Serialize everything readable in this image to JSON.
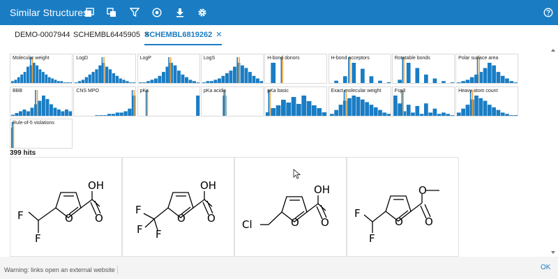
{
  "app": {
    "title": "Similar Structures"
  },
  "toolbar": {
    "icons": [
      "gallery-icon",
      "copy-icon",
      "filter-icon",
      "palette-icon",
      "download-icon",
      "gear-icon",
      "help-icon"
    ]
  },
  "tabs": [
    {
      "label": "DEMO-0007944",
      "closable": false,
      "active": false
    },
    {
      "label": "SCHEMBL6445905",
      "closable": true,
      "active": false
    },
    {
      "label": "SCHEMBL6819262",
      "closable": true,
      "active": true
    }
  ],
  "histograms": [
    {
      "label": "Molecular weight",
      "bars": [
        2,
        3,
        5,
        7,
        9,
        13,
        14,
        16,
        14,
        11,
        9,
        7,
        5,
        4,
        3,
        2,
        2,
        1,
        1,
        1
      ],
      "markers": [
        0.31,
        0.34
      ]
    },
    {
      "label": "LogD",
      "bars": [
        1,
        2,
        3,
        5,
        7,
        9,
        11,
        14,
        16,
        13,
        11,
        8,
        6,
        4,
        3,
        2,
        1,
        1
      ],
      "markers": [
        0.44,
        0.47
      ]
    },
    {
      "label": "LogP",
      "bars": [
        1,
        1,
        2,
        3,
        4,
        6,
        9,
        13,
        16,
        14,
        10,
        7,
        5,
        3,
        2,
        1
      ],
      "markers": [
        0.48,
        0.51
      ]
    },
    {
      "label": "LogS",
      "bars": [
        1,
        2,
        2,
        3,
        4,
        6,
        8,
        10,
        13,
        16,
        14,
        12,
        9,
        6,
        4,
        2
      ],
      "markers": [
        0.56,
        0.59
      ]
    },
    {
      "label": "H-bond donors",
      "bars": [
        0,
        16,
        0,
        0,
        0,
        0,
        0,
        0,
        0,
        0,
        0,
        0
      ],
      "markers": [
        0.25,
        0.27
      ]
    },
    {
      "label": "H-bond acceptors",
      "bars": [
        0,
        2,
        0,
        5,
        0,
        14,
        0,
        10,
        0,
        5,
        0,
        2,
        0,
        1
      ],
      "markers": [
        0.3,
        0.32
      ]
    },
    {
      "label": "Rotatable bonds",
      "bars": [
        0,
        3,
        0,
        16,
        0,
        12,
        0,
        7,
        0,
        4,
        0,
        2,
        0,
        1
      ],
      "markers": [
        0.15,
        0.17
      ]
    },
    {
      "label": "Polar surface area",
      "bars": [
        1,
        2,
        3,
        5,
        7,
        9,
        12,
        16,
        14,
        9,
        6,
        4,
        2,
        1
      ],
      "markers": [
        0.33,
        0.36
      ]
    },
    {
      "label": "BBB",
      "bars": [
        1,
        2,
        3,
        4,
        3,
        5,
        7,
        9,
        12,
        10,
        7,
        5,
        4,
        3,
        4,
        3
      ],
      "markers": [
        0.39,
        0.42
      ]
    },
    {
      "label": "CNS MPO",
      "bars": [
        0,
        0,
        0,
        0,
        0,
        1,
        1,
        1,
        2,
        2,
        3,
        3,
        4,
        6,
        16
      ],
      "markers": [
        0.92,
        0.95
      ]
    },
    {
      "label": "pKa",
      "bars": [
        0,
        0,
        0,
        0,
        0,
        0,
        0,
        0,
        0,
        0,
        0,
        0,
        0,
        0,
        16
      ],
      "markers": [
        0.12,
        0.14
      ]
    },
    {
      "label": "pKa acidic",
      "bars": [
        0,
        0,
        0,
        0,
        0,
        16,
        0,
        0,
        0,
        0,
        0,
        0,
        0,
        0,
        0
      ],
      "markers": [
        0.35,
        0.37
      ]
    },
    {
      "label": "pKa basic",
      "bars": [
        3,
        6,
        8,
        12,
        10,
        14,
        9,
        15,
        11,
        8,
        6,
        3
      ],
      "markers": [
        0.05,
        0.07
      ]
    },
    {
      "label": "Exact molecular weight",
      "bars": [
        2,
        5,
        9,
        12,
        14,
        16,
        15,
        13,
        11,
        9,
        7,
        5,
        3,
        2
      ],
      "markers": [
        0.23,
        0.26
      ]
    },
    {
      "label": "Fsp3",
      "bars": [
        16,
        10,
        4,
        9,
        3,
        8,
        2,
        10,
        3,
        6,
        2,
        3,
        2,
        1
      ],
      "markers": [
        0.14,
        0.16
      ]
    },
    {
      "label": "Heavy atom count",
      "bars": [
        3,
        6,
        9,
        13,
        16,
        14,
        12,
        9,
        7,
        5,
        3,
        2,
        1,
        1
      ],
      "markers": [
        0.22,
        0.25
      ]
    },
    {
      "label": "Rule-of-5 violations",
      "bars": [
        16,
        0,
        0,
        0,
        0,
        0,
        0,
        0,
        0,
        0,
        0,
        0,
        0,
        0,
        0,
        0,
        0,
        0,
        0,
        0,
        0,
        0,
        0,
        0,
        0,
        0,
        0,
        0,
        0,
        0
      ],
      "markers": [
        0.02,
        0.04
      ]
    }
  ],
  "colors": {
    "bar": "#1a7dc4",
    "marker_blue": "#1a7dc4",
    "marker_orange": "#f0a33a",
    "accent": "#1a7dc4"
  },
  "results": {
    "hits_label": "399 hits",
    "structures": [
      {
        "substituent": [
          "F",
          "F"
        ],
        "acid": "OH"
      },
      {
        "substituent": [
          "F",
          "F",
          "F"
        ],
        "acid": "OH"
      },
      {
        "substituent": [
          "Cl"
        ],
        "acid": "OH"
      },
      {
        "substituent": [
          "F",
          "F"
        ],
        "acid": ""
      }
    ]
  },
  "footer": {
    "warning": "Warning: links open an external website",
    "ok_label": "OK"
  }
}
